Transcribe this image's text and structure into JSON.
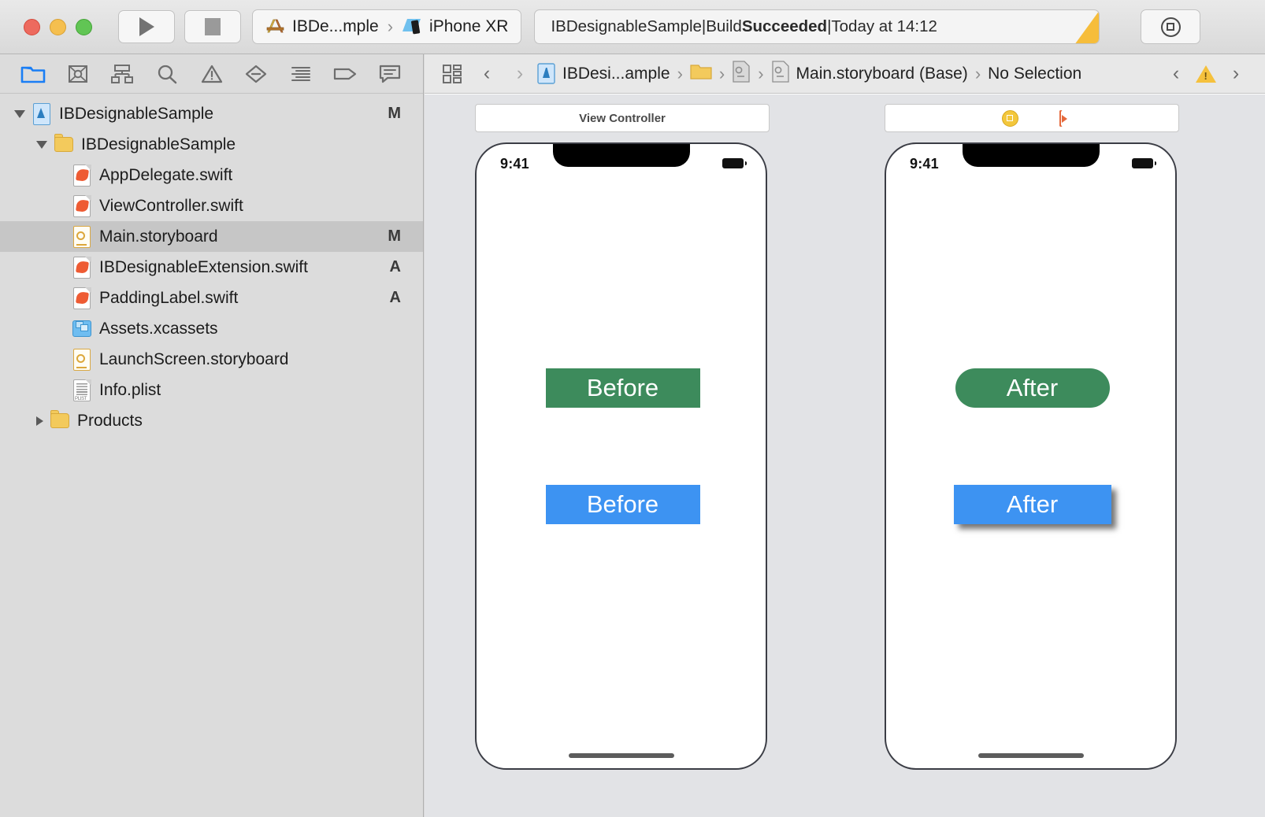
{
  "window": {
    "traffic_lights": [
      "close",
      "minimize",
      "zoom"
    ]
  },
  "toolbar": {
    "run_label": "Run",
    "stop_label": "Stop",
    "scheme_name": "IBDe...mple",
    "destination_name": "iPhone XR",
    "scheme_separator": "›",
    "status_project": "IBDesignableSample",
    "status_sep1": " | ",
    "status_build_prefix": "Build ",
    "status_build_result": "Succeeded",
    "status_sep2": " | ",
    "status_time": "Today at 14:12",
    "library_button_label": "Library",
    "warning_indicator": "warning-corner"
  },
  "navigator": {
    "tabs": [
      {
        "name": "project-navigator",
        "icon": "folder-icon",
        "active": true
      },
      {
        "name": "source-control-navigator",
        "icon": "source-control-icon",
        "active": false
      },
      {
        "name": "symbol-navigator",
        "icon": "symbol-hierarchy-icon",
        "active": false
      },
      {
        "name": "find-navigator",
        "icon": "search-icon",
        "active": false
      },
      {
        "name": "issue-navigator",
        "icon": "warning-triangle-icon",
        "active": false
      },
      {
        "name": "test-navigator",
        "icon": "test-diamond-icon",
        "active": false
      },
      {
        "name": "debug-navigator",
        "icon": "debug-lines-icon",
        "active": false
      },
      {
        "name": "breakpoint-navigator",
        "icon": "breakpoint-tag-icon",
        "active": false
      },
      {
        "name": "report-navigator",
        "icon": "report-bubble-icon",
        "active": false
      }
    ],
    "files": [
      {
        "label": "IBDesignableSample",
        "icon": "xcode-project-icon",
        "indent": 0,
        "twisty": "open",
        "badge": "M",
        "selected": false
      },
      {
        "label": "IBDesignableSample",
        "icon": "folder-icon",
        "indent": 1,
        "twisty": "open",
        "badge": "",
        "selected": false
      },
      {
        "label": "AppDelegate.swift",
        "icon": "swift-file-icon",
        "indent": 2,
        "twisty": "none",
        "badge": "",
        "selected": false
      },
      {
        "label": "ViewController.swift",
        "icon": "swift-file-icon",
        "indent": 2,
        "twisty": "none",
        "badge": "",
        "selected": false
      },
      {
        "label": "Main.storyboard",
        "icon": "storyboard-file-icon",
        "indent": 2,
        "twisty": "none",
        "badge": "M",
        "selected": true
      },
      {
        "label": "IBDesignableExtension.swift",
        "icon": "swift-file-icon",
        "indent": 2,
        "twisty": "none",
        "badge": "A",
        "selected": false
      },
      {
        "label": "PaddingLabel.swift",
        "icon": "swift-file-icon",
        "indent": 2,
        "twisty": "none",
        "badge": "A",
        "selected": false
      },
      {
        "label": "Assets.xcassets",
        "icon": "xcassets-icon",
        "indent": 2,
        "twisty": "none",
        "badge": "",
        "selected": false
      },
      {
        "label": "LaunchScreen.storyboard",
        "icon": "storyboard-file-icon",
        "indent": 2,
        "twisty": "none",
        "badge": "",
        "selected": false
      },
      {
        "label": "Info.plist",
        "icon": "plist-file-icon",
        "indent": 2,
        "twisty": "none",
        "badge": "",
        "selected": false
      },
      {
        "label": "Products",
        "icon": "folder-icon",
        "indent": 1,
        "twisty": "closed",
        "badge": "",
        "selected": false
      }
    ]
  },
  "editor": {
    "jumpbar": {
      "related_items_icon": "related-items-grid-icon",
      "back_label": "‹",
      "forward_label": "›",
      "crumbs": [
        {
          "label": "IBDesi...ample",
          "icon": "xcode-project-icon"
        },
        {
          "label": "",
          "icon": "folder-icon"
        },
        {
          "label": "",
          "icon": "storyboard-file-icon"
        },
        {
          "label": "Main.storyboard (Base)",
          "icon": "storyboard-file-icon"
        },
        {
          "label": "No Selection",
          "icon": ""
        }
      ],
      "separator": "›",
      "prev_issue_label": "‹",
      "next_issue_label": "›",
      "issue_icon": "warning-triangle-icon"
    },
    "canvas": {
      "background_color": "#e2e3e6",
      "scenes": [
        {
          "name": "view-controller-scene-before",
          "dock_title": "View Controller",
          "dock_icons": [],
          "status_time": "9:41",
          "buttons": [
            {
              "label": "Before",
              "color": "#3d8b5c",
              "shape": "rect",
              "shadow": false
            },
            {
              "label": "Before",
              "color": "#3d93f2",
              "shape": "rect",
              "shadow": false
            }
          ]
        },
        {
          "name": "view-controller-scene-after",
          "dock_title": "",
          "dock_icons": [
            "view-controller-dock-icon",
            "first-responder-dock-icon",
            "exit-dock-icon"
          ],
          "status_time": "9:41",
          "buttons": [
            {
              "label": "After",
              "color": "#3d8b5c",
              "shape": "pill",
              "shadow": false
            },
            {
              "label": "After",
              "color": "#3d93f2",
              "shape": "rect",
              "shadow": true
            }
          ]
        }
      ]
    }
  }
}
